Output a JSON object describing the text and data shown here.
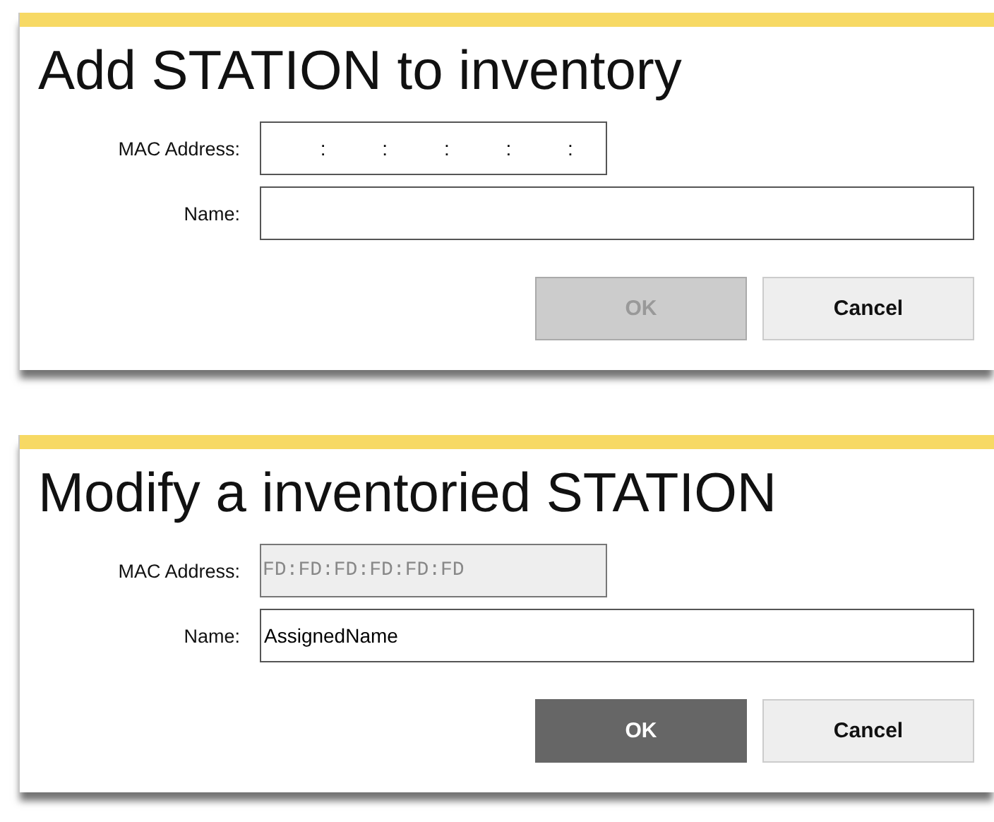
{
  "dialogs": [
    {
      "title": "Add STATION to inventory",
      "fields": [
        {
          "label": "MAC Address:",
          "kind": "mac",
          "value": " : : : : :",
          "disabled": false
        },
        {
          "label": "Name:",
          "kind": "text",
          "disabled": false
        }
      ],
      "buttons": [
        {
          "label": "OK",
          "kind": "primary",
          "disabled": true
        },
        {
          "label": "Cancel",
          "kind": "secondary",
          "disabled": false
        }
      ]
    },
    {
      "title": "Modify a inventoried STATION",
      "fields": [
        {
          "label": "MAC Address:",
          "kind": "mac",
          "value": "FD:FD:FD:FD:FD:FD",
          "disabled": true
        },
        {
          "label": "Name:",
          "kind": "text",
          "value": "AssignedName",
          "disabled": false
        }
      ],
      "buttons": [
        {
          "label": "OK",
          "kind": "primary",
          "disabled": false
        },
        {
          "label": "Cancel",
          "kind": "secondary",
          "disabled": false
        }
      ]
    }
  ]
}
